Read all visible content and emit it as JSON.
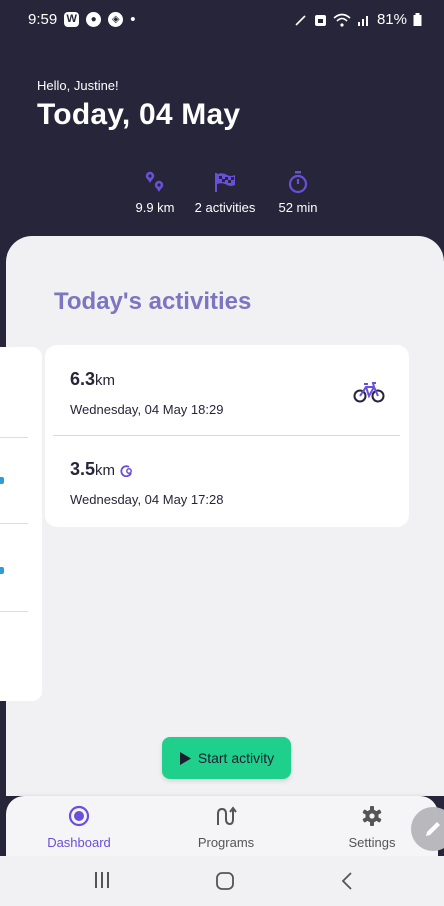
{
  "status_bar": {
    "time": "9:59",
    "notif_icons": [
      "w-app-icon",
      "profile-icon",
      "compass-icon"
    ],
    "dot": "•",
    "battery": "81%"
  },
  "header": {
    "greeting": "Hello, Justine!",
    "date": "Today, 04 May",
    "stats": {
      "distance": "9.9 km",
      "activities": "2 activities",
      "duration": "52 min"
    }
  },
  "main": {
    "section_title": "Today's activities",
    "activities": [
      {
        "distance_value": "6.3",
        "distance_unit": "km",
        "datetime": "Wednesday, 04 May 18:29",
        "icon": "bicycle-icon"
      },
      {
        "distance_value": "3.5",
        "distance_unit": "km",
        "datetime": "Wednesday, 04 May 17:28",
        "icon": "loop-icon"
      }
    ]
  },
  "start_button": {
    "label": "Start activity"
  },
  "bottom_nav": {
    "items": [
      {
        "label": "Dashboard",
        "active": true
      },
      {
        "label": "Programs",
        "active": false
      },
      {
        "label": "Settings",
        "active": false
      }
    ]
  },
  "colors": {
    "header_bg": "#272539",
    "accent_purple": "#6a4fd9",
    "title_purple": "#7d74c2",
    "start_green": "#1fd08c"
  }
}
